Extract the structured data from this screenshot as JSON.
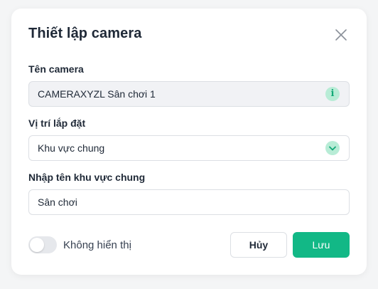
{
  "dialog": {
    "title": "Thiết lập camera",
    "close_icon": "close-icon"
  },
  "camera_name": {
    "label": "Tên camera",
    "value": "CAMERAXYZL Sân chơi 1",
    "icon": "info-icon",
    "icon_glyph": "i"
  },
  "install_location": {
    "label": "Vị trí lắp đặt",
    "selected": "Khu vực chung",
    "icon": "chevron-down-icon"
  },
  "area_name": {
    "label": "Nhập tên khu vực chung",
    "value": "Sân chơi"
  },
  "visibility_toggle": {
    "label": "Không hiển thị",
    "on": false
  },
  "actions": {
    "cancel_label": "Hủy",
    "save_label": "Lưu"
  },
  "colors": {
    "accent": "#12b886",
    "accent_light": "#b8ecd6",
    "text": "#1f2937",
    "border": "#dcdfe4",
    "disabled_bg": "#f1f2f5"
  }
}
